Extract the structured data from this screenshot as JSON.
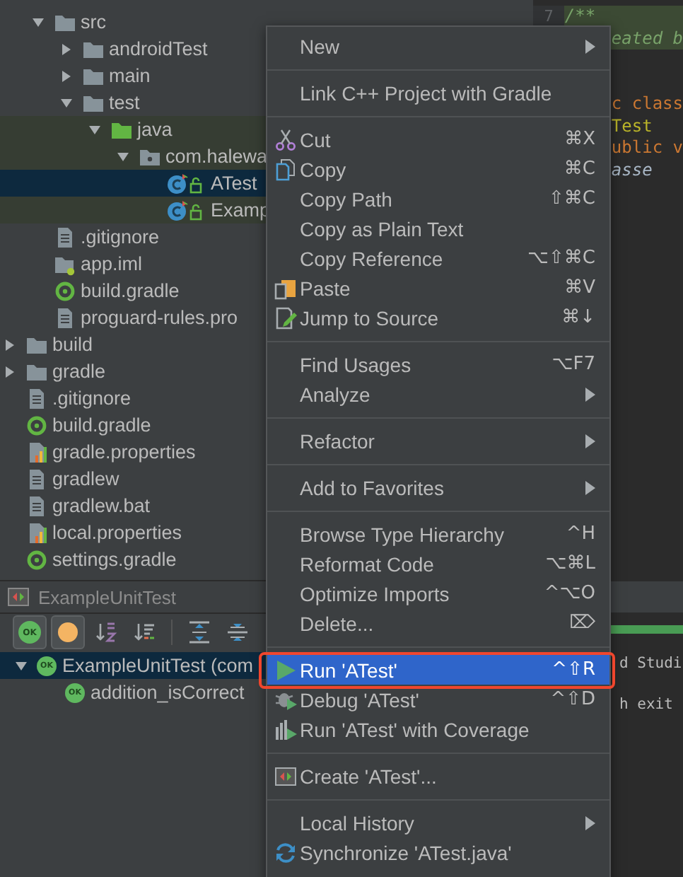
{
  "project_tree": {
    "items": [
      {
        "children": [
          {
            "label": "src",
            "kind": "folder",
            "expanded": true,
            "selected": false,
            "children": [
              {
                "label": "androidTest",
                "kind": "folder",
                "expanded": false,
                "selected": false
              },
              {
                "label": "main",
                "kind": "folder",
                "expanded": false,
                "selected": false
              },
              {
                "label": "test",
                "kind": "folder",
                "expanded": true,
                "selected": false,
                "children": [
                  {
                    "label": "java",
                    "kind": "test-root",
                    "expanded": true,
                    "tinted": true,
                    "selected": false,
                    "children": [
                      {
                        "label": "com.halewa",
                        "kind": "package",
                        "expanded": true,
                        "tinted": true,
                        "selected": false,
                        "children": [
                          {
                            "label": "ATest",
                            "kind": "test-class",
                            "selected": true
                          },
                          {
                            "label": "Examp",
                            "kind": "test-class",
                            "tinted": true,
                            "selected": false
                          }
                        ]
                      }
                    ]
                  }
                ]
              }
            ]
          },
          {
            "label": ".gitignore",
            "kind": "file",
            "selected": false
          },
          {
            "label": "app.iml",
            "kind": "iml",
            "selected": false
          },
          {
            "label": "build.gradle",
            "kind": "gradle",
            "selected": false
          },
          {
            "label": "proguard-rules.pro",
            "kind": "file",
            "selected": false
          }
        ]
      },
      {
        "label": "build",
        "kind": "folder",
        "expanded": false,
        "selected": false
      },
      {
        "label": "gradle",
        "kind": "folder",
        "expanded": false,
        "selected": false
      },
      {
        "label": ".gitignore",
        "kind": "file",
        "selected": false
      },
      {
        "label": "build.gradle",
        "kind": "gradle",
        "selected": false
      },
      {
        "label": "gradle.properties",
        "kind": "properties",
        "selected": false
      },
      {
        "label": "gradlew",
        "kind": "file",
        "selected": false
      },
      {
        "label": "gradlew.bat",
        "kind": "file",
        "selected": false
      },
      {
        "label": "local.properties",
        "kind": "properties",
        "selected": false
      },
      {
        "label": "settings.gradle",
        "kind": "gradle",
        "selected": false
      }
    ]
  },
  "editor": {
    "lines": [
      {
        "number": "7",
        "text": "/**",
        "kind": "doc-comment",
        "partly_covered": false
      },
      {
        "text": "eated b",
        "kind": "doc-comment",
        "partly_covered": true
      },
      {
        "kind": "covered"
      },
      {
        "kind": "covered"
      },
      {
        "text": "c class",
        "kind": "keyword",
        "partly_covered": true
      },
      {
        "text": "Test",
        "kind": "annotation",
        "partly_covered": true
      },
      {
        "text": "ublic v",
        "kind": "keyword",
        "partly_covered": true
      },
      {
        "text": "asse",
        "kind": "call",
        "partly_covered": true
      }
    ]
  },
  "run_panel": {
    "title": "ExampleUnitTest",
    "toolbar": [
      {
        "kind": "passed-filter",
        "badge": "OK",
        "pressed": true
      },
      {
        "kind": "ignored-filter",
        "pressed": true
      },
      {
        "kind": "sort-alphabetically",
        "pressed": false
      },
      {
        "kind": "sort-by-duration",
        "pressed": false
      },
      {
        "kind": "separator"
      },
      {
        "kind": "expand-all",
        "pressed": false
      },
      {
        "kind": "collapse-all",
        "pressed": false
      }
    ],
    "results": [
      {
        "label": "ExampleUnitTest (com",
        "badge": "OK",
        "expanded": true,
        "selected": true,
        "children": [
          {
            "label": "addition_isCorrect",
            "badge": "OK",
            "selected": false
          }
        ]
      }
    ]
  },
  "console": {
    "progress": {
      "level": 1
    },
    "lines": [
      "d Studi",
      "h exit"
    ]
  },
  "context_menu": {
    "groups": [
      [
        {
          "label": "New",
          "submenu": true,
          "selected": false
        }
      ],
      [
        {
          "label": "Link C++ Project with Gradle",
          "selected": false
        }
      ],
      [
        {
          "label": "Cut",
          "kind": "scissors",
          "shortcut": "⌘X",
          "selected": false
        },
        {
          "label": "Copy",
          "kind": "copy",
          "shortcut": "⌘C",
          "selected": false
        },
        {
          "label": "Copy Path",
          "shortcut": "⇧⌘C",
          "selected": false
        },
        {
          "label": "Copy as Plain Text",
          "selected": false
        },
        {
          "label": "Copy Reference",
          "shortcut": "⌥⇧⌘C",
          "selected": false
        },
        {
          "label": "Paste",
          "kind": "paste",
          "shortcut": "⌘V",
          "selected": false
        },
        {
          "label": "Jump to Source",
          "kind": "jump",
          "shortcut": "⌘↓",
          "selected": false
        }
      ],
      [
        {
          "label": "Find Usages",
          "shortcut": "⌥F7",
          "selected": false
        },
        {
          "label": "Analyze",
          "submenu": true,
          "selected": false
        }
      ],
      [
        {
          "label": "Refactor",
          "submenu": true,
          "selected": false
        }
      ],
      [
        {
          "label": "Add to Favorites",
          "submenu": true,
          "selected": false
        }
      ],
      [
        {
          "label": "Browse Type Hierarchy",
          "shortcut": "^H",
          "selected": false
        },
        {
          "label": "Reformat Code",
          "shortcut": "⌥⌘L",
          "selected": false
        },
        {
          "label": "Optimize Imports",
          "shortcut": "^⌥O",
          "selected": false
        },
        {
          "label": "Delete...",
          "shortcut": "⌦",
          "selected": false
        }
      ],
      [
        {
          "label": "Run 'ATest'",
          "kind": "run",
          "shortcut": "^⇧R",
          "selected": true,
          "annotated": true
        },
        {
          "label": "Debug 'ATest'",
          "kind": "debug",
          "shortcut": "^⇧D",
          "selected": false
        },
        {
          "label": "Run 'ATest' with Coverage",
          "kind": "coverage",
          "selected": false
        }
      ],
      [
        {
          "label": "Create 'ATest'...",
          "kind": "create",
          "selected": false
        }
      ],
      [
        {
          "label": "Local History",
          "submenu": true,
          "selected": false
        },
        {
          "label": "Synchronize 'ATest.java'",
          "kind": "sync",
          "selected": false
        }
      ]
    ]
  }
}
